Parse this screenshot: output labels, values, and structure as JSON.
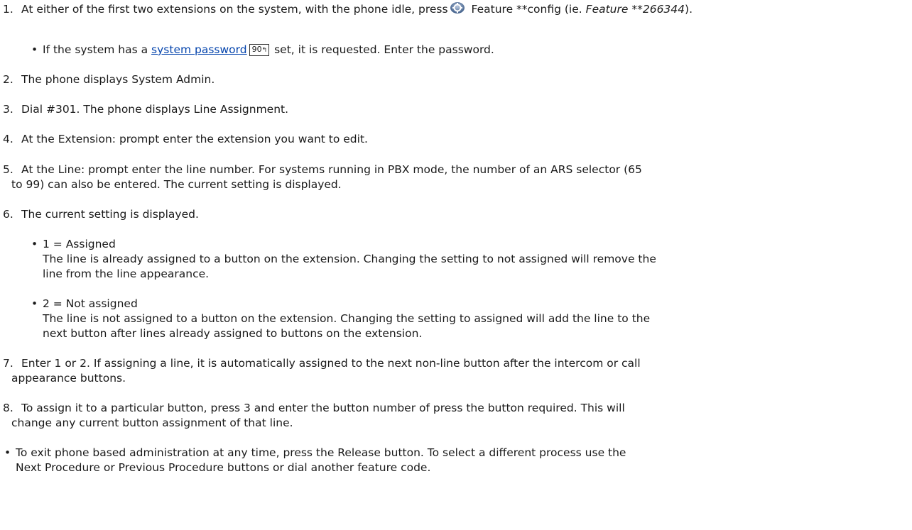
{
  "steps": [
    {
      "number": "1.",
      "text_before_icon": "At either of the first two extensions on the system, with the phone idle, press",
      "icon": "feature-button-icon",
      "text_after_icon": "Feature **config (ie.",
      "example": "Feature **266344",
      "text_end": ").",
      "sub": {
        "before": "If the system has a",
        "link": "system password",
        "page_ref": "90",
        "after": "set, it is requested. Enter the password."
      }
    },
    {
      "number": "2.",
      "text": "The phone displays System Admin."
    },
    {
      "number": "3.",
      "text": "Dial #301. The phone displays Line Assignment."
    },
    {
      "number": "4.",
      "text": "At the Extension: prompt enter the extension you want to edit."
    },
    {
      "number": "5.",
      "line1": "At the Line: prompt enter the line number. For systems running in PBX mode, the number of an ARS selector (65",
      "line2": "to 99) can also be entered. The current setting is displayed."
    },
    {
      "number": "6.",
      "text": "The current setting is displayed.",
      "options": [
        {
          "title": "1 = Assigned",
          "line1": "The line is already assigned to a button on the extension. Changing the setting to not assigned will remove the",
          "line2": "line from the line appearance."
        },
        {
          "title": "2 = Not assigned",
          "line1": "The line is not assigned to a button on the extension. Changing the setting to assigned will add the line to the",
          "line2": "next button after lines already assigned to buttons on the extension."
        }
      ]
    },
    {
      "number": "7.",
      "line1": "Enter 1 or 2. If assigning a line, it is automatically assigned to the next non-line button after the intercom or call",
      "line2": "appearance buttons."
    },
    {
      "number": "8.",
      "line1": "To assign it to a particular button, press 3 and enter the button number of press the button required. This will",
      "line2": "change any current button assignment of that line."
    }
  ],
  "note": {
    "line1": "To exit phone based administration at any time, press the Release button. To select a different process use the",
    "line2": "Next Procedure or Previous Procedure buttons or dial another feature code."
  },
  "colors": {
    "text": "#1a1a1a",
    "link": "#0645ad"
  }
}
